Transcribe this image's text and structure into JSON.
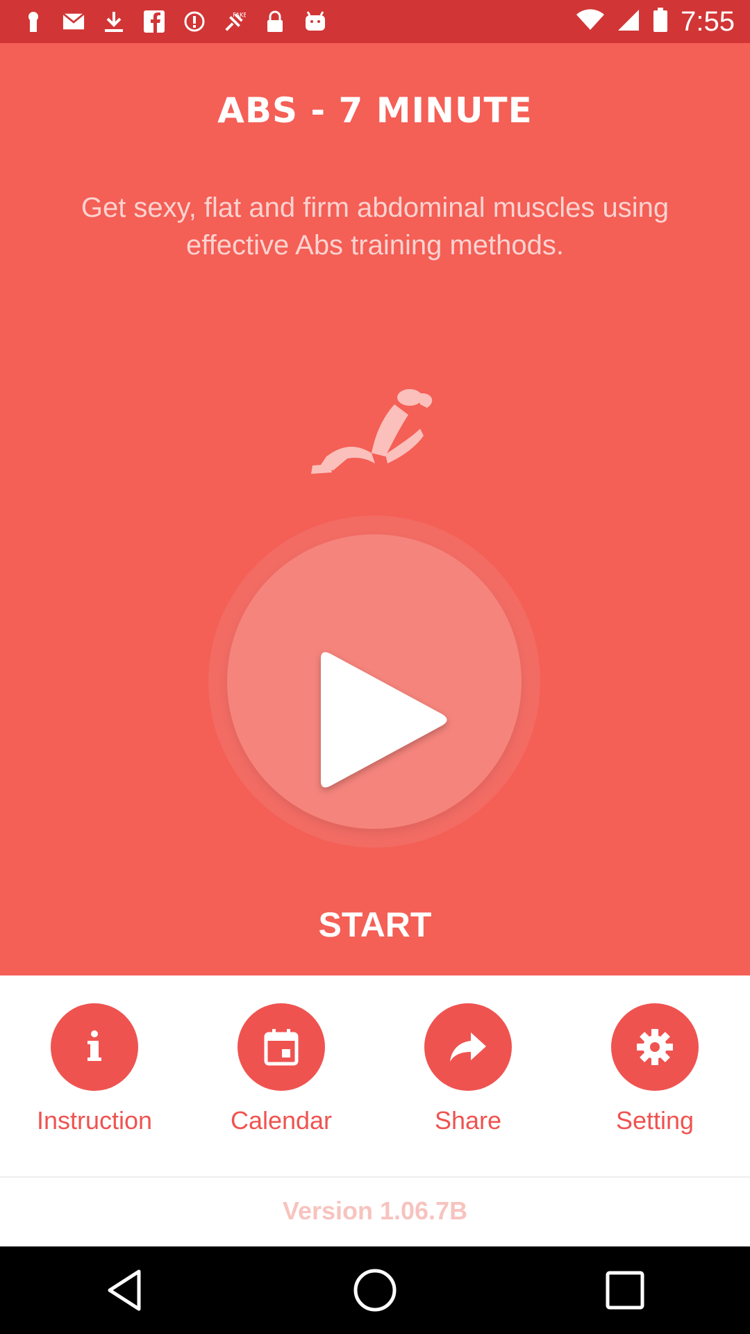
{
  "status_bar": {
    "time": "7:55",
    "icons": [
      "keyhole-icon",
      "mail-icon",
      "download-icon",
      "facebook-icon",
      "alert-icon",
      "fake-gps-icon",
      "lock-icon",
      "android-icon",
      "wifi-icon",
      "signal-icon",
      "battery-icon"
    ]
  },
  "hero": {
    "title": "ABS - 7 MINUTE",
    "subtitle": "Get sexy, flat and firm abdominal muscles using effective Abs training methods.",
    "start_label": "START"
  },
  "bottom_nav": {
    "items": [
      {
        "label": "Instruction",
        "icon": "info-icon"
      },
      {
        "label": "Calendar",
        "icon": "calendar-icon"
      },
      {
        "label": "Share",
        "icon": "share-icon"
      },
      {
        "label": "Setting",
        "icon": "gear-icon"
      }
    ]
  },
  "version": "Version 1.06.7B",
  "colors": {
    "status_bar": "#d23535",
    "hero": "#f45f56",
    "accent": "#ef5350"
  }
}
